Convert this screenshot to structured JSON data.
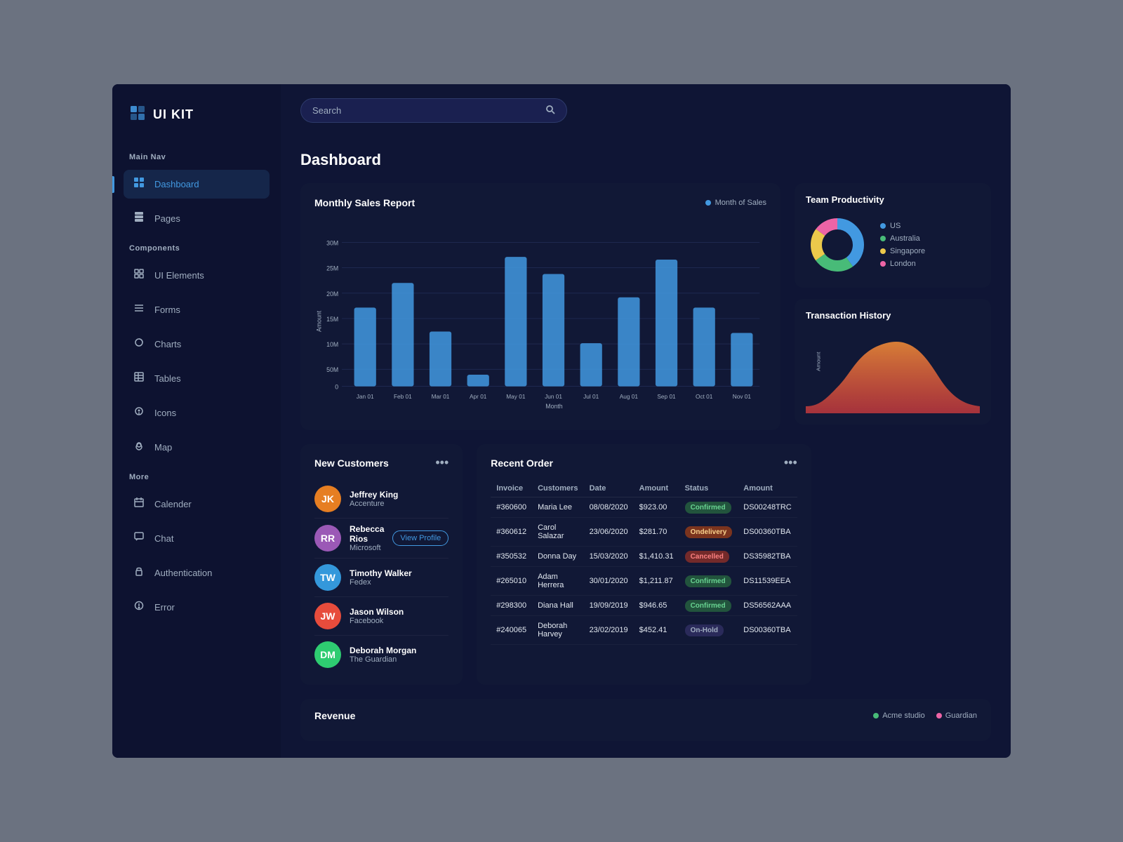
{
  "app": {
    "name": "UI KIT"
  },
  "sidebar": {
    "main_nav_label": "Main Nav",
    "items_main": [
      {
        "id": "dashboard",
        "label": "Dashboard",
        "icon": "⊞",
        "active": true
      },
      {
        "id": "pages",
        "label": "Pages",
        "icon": "▦"
      }
    ],
    "components_label": "Components",
    "items_components": [
      {
        "id": "ui-elements",
        "label": "UI Elements",
        "icon": "⊡"
      },
      {
        "id": "forms",
        "label": "Forms",
        "icon": "≡"
      },
      {
        "id": "charts",
        "label": "Charts",
        "icon": "◑"
      },
      {
        "id": "tables",
        "label": "Tables",
        "icon": "⊞"
      },
      {
        "id": "icons",
        "label": "Icons",
        "icon": "☺"
      },
      {
        "id": "map",
        "label": "Map",
        "icon": "◎"
      }
    ],
    "more_label": "More",
    "items_more": [
      {
        "id": "calendar",
        "label": "Calender",
        "icon": "◫"
      },
      {
        "id": "chat",
        "label": "Chat",
        "icon": "⊟"
      },
      {
        "id": "authentication",
        "label": "Authentication",
        "icon": "⊟"
      },
      {
        "id": "error",
        "label": "Error",
        "icon": "⊙"
      }
    ]
  },
  "header": {
    "search_placeholder": "Search"
  },
  "page": {
    "title": "Dashboard"
  },
  "monthly_sales": {
    "title": "Monthly Sales Report",
    "legend": "Month of Sales",
    "y_labels": [
      "30M",
      "25M",
      "20M",
      "15M",
      "10M",
      "50M",
      "0"
    ],
    "x_labels": [
      "Jan 01",
      "Feb 01",
      "Mar 01",
      "Apr 01",
      "May 01",
      "Jun 01",
      "Jul 01",
      "Aug 01",
      "Sep 01",
      "Oct 01",
      "Nov 01"
    ],
    "axis_label_y": "Amount",
    "axis_label_x": "Month",
    "bars": [
      {
        "month": "Jan 01",
        "value": 55
      },
      {
        "month": "Feb 01",
        "value": 72
      },
      {
        "month": "Mar 01",
        "value": 38
      },
      {
        "month": "Apr 01",
        "value": 8
      },
      {
        "month": "May 01",
        "value": 90
      },
      {
        "month": "Jun 01",
        "value": 78
      },
      {
        "month": "Jul 01",
        "value": 30
      },
      {
        "month": "Aug 01",
        "value": 62
      },
      {
        "month": "Sep 01",
        "value": 88
      },
      {
        "month": "Oct 01",
        "value": 55
      },
      {
        "month": "Nov 01",
        "value": 37
      }
    ]
  },
  "team_productivity": {
    "title": "Team Productivity",
    "segments": [
      {
        "label": "US",
        "color": "#4299e1",
        "value": 40
      },
      {
        "label": "Australia",
        "color": "#48bb78",
        "value": 25
      },
      {
        "label": "Singapore",
        "color": "#ecc94b",
        "value": 20
      },
      {
        "label": "London",
        "color": "#ed64a6",
        "value": 15
      }
    ]
  },
  "transaction_history": {
    "title": "Transaction History"
  },
  "new_customers": {
    "title": "New Customers",
    "customers": [
      {
        "name": "Jeffrey King",
        "company": "Accenture",
        "avatar_color": "#e67e22",
        "initials": "JK",
        "show_btn": false
      },
      {
        "name": "Rebecca Rios",
        "company": "Microsoft",
        "avatar_color": "#9b59b6",
        "initials": "RR",
        "show_btn": true
      },
      {
        "name": "Timothy Walker",
        "company": "Fedex",
        "avatar_color": "#3498db",
        "initials": "TW",
        "show_btn": false
      },
      {
        "name": "Jason Wilson",
        "company": "Facebook",
        "avatar_color": "#e74c3c",
        "initials": "JW",
        "show_btn": false
      },
      {
        "name": "Deborah Morgan",
        "company": "The Guardian",
        "avatar_color": "#2ecc71",
        "initials": "DM",
        "show_btn": false
      }
    ],
    "view_profile_label": "View Profile"
  },
  "recent_orders": {
    "title": "Recent Order",
    "columns": [
      "Invoice",
      "Customers",
      "Date",
      "Amount",
      "Status",
      "Amount"
    ],
    "rows": [
      {
        "invoice": "#360600",
        "customer": "Maria Lee",
        "date": "08/08/2020",
        "amount": "$923.00",
        "status": "Confirmed",
        "status_class": "status-confirmed",
        "ref": "DS00248TRC"
      },
      {
        "invoice": "#360612",
        "customer": "Carol Salazar",
        "date": "23/06/2020",
        "amount": "$281.70",
        "status": "Ondelivery",
        "status_class": "status-ondelivery",
        "ref": "DS00360TBA"
      },
      {
        "invoice": "#350532",
        "customer": "Donna Day",
        "date": "15/03/2020",
        "amount": "$1,410.31",
        "status": "Cancelled",
        "status_class": "status-cancelled",
        "ref": "DS35982TBA"
      },
      {
        "invoice": "#265010",
        "customer": "Adam Herrera",
        "date": "30/01/2020",
        "amount": "$1,211.87",
        "status": "Confirmed",
        "status_class": "status-confirmed",
        "ref": "DS11539EEA"
      },
      {
        "invoice": "#298300",
        "customer": "Diana Hall",
        "date": "19/09/2019",
        "amount": "$946.65",
        "status": "Confirmed",
        "status_class": "status-confirmed",
        "ref": "DS56562AAA"
      },
      {
        "invoice": "#240065",
        "customer": "Deborah Harvey",
        "date": "23/02/2019",
        "amount": "$452.41",
        "status": "On-Hold",
        "status_class": "status-onhold",
        "ref": "DS00360TBA"
      }
    ]
  },
  "revenue": {
    "title": "Revenue",
    "legend": [
      {
        "label": "Acme studio",
        "color": "#48bb78"
      },
      {
        "label": "Guardian",
        "color": "#ed64a6"
      }
    ]
  }
}
